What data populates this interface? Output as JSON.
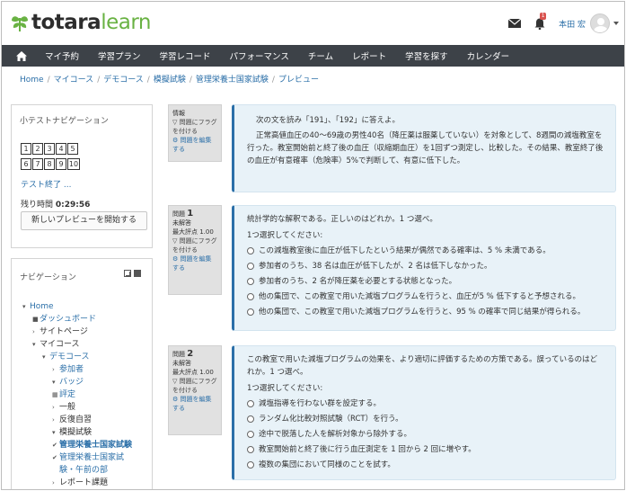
{
  "brand": {
    "name_bold": "totara",
    "name_light": "learn",
    "leaf_color": "#69b243"
  },
  "header": {
    "notifications_count": "1",
    "user_name": "本田 宏"
  },
  "nav": [
    "マイ予約",
    "学習プラン",
    "学習レコード",
    "パフォーマンス",
    "チーム",
    "レポート",
    "学習を探す",
    "カレンダー"
  ],
  "breadcrumb": {
    "items": [
      "Home",
      "マイコース",
      "デモコース",
      "模擬試験",
      "管理栄養士国家試験"
    ],
    "current": "プレビュー"
  },
  "quiz_nav": {
    "title": "小テストナビゲーション",
    "buttons_row1": [
      "1",
      "2",
      "3",
      "4",
      "5"
    ],
    "buttons_row2": [
      "6",
      "7",
      "8",
      "9",
      "10"
    ],
    "finish_link": "テスト終了 ...",
    "time_label": "残り時間",
    "time_value": "0:29:56",
    "new_preview_button": "新しいプレビューを開始する"
  },
  "navigation": {
    "title": "ナビゲーション",
    "tree": [
      {
        "mk": "▾",
        "label": "Home",
        "indent": 0
      },
      {
        "mk": "■",
        "label": "ダッシュボード",
        "indent": 1
      },
      {
        "mk": "›",
        "label": "サイトページ",
        "indent": 1,
        "dark": true
      },
      {
        "mk": "▾",
        "label": "マイコース",
        "indent": 1,
        "dark": true
      },
      {
        "mk": "▾",
        "label": "デモコース",
        "indent": 2
      },
      {
        "mk": "›",
        "label": "参加者",
        "indent": 3
      },
      {
        "mk": "▾",
        "label": "バッジ",
        "indent": 3
      },
      {
        "mk": "▦",
        "label": "評定",
        "indent": 3
      },
      {
        "mk": "›",
        "label": "一般",
        "indent": 3,
        "dark": true
      },
      {
        "mk": "›",
        "label": "反復自習",
        "indent": 3,
        "dark": true
      },
      {
        "mk": "▾",
        "label": "模擬試験",
        "indent": 3,
        "dark": true
      },
      {
        "mk": "✔",
        "label": "管理栄養士国家試験",
        "indent": 3,
        "bold": true
      },
      {
        "mk": "✔",
        "label": "管理栄養士国家試",
        "indent": 3
      },
      {
        "mk": "",
        "label": "験・午前の部",
        "indent": 3
      },
      {
        "mk": "›",
        "label": "レポート課題",
        "indent": 3,
        "dark": true
      }
    ]
  },
  "info_block": {
    "label": "情報",
    "flag": "問題にフラグを付ける",
    "edit": "問題を編集する",
    "text1": "次の文を読み「191」、「192」に答えよ。",
    "text2": "正常高値血圧の40〜69歳の男性40名（降圧薬は服薬していない）を対象として、8週間の減塩教室を行った。教室開始前と終了後の血圧（収縮期血圧）を1回ずつ測定し、比較した。その結果、教室終了後の血圧が有意確率（危険率）5%で判断して、有意に低下した。"
  },
  "questions": [
    {
      "label": "問題",
      "number": "1",
      "status": "未解答",
      "points": "最大評点 1.00",
      "flag": "問題にフラグを付ける",
      "edit": "問題を編集する",
      "text": "統計学的な解釈である。正しいのはどれか。1 つ選べ。",
      "prompt": "1つ選択してください:",
      "options": [
        "この減塩教室後に血圧が低下したという結果が偶然である確率は、5 % 未満である。",
        "参加者のうち、38 名は血圧が低下したが、2 名は低下しなかった。",
        "参加者のうち、2 名が降圧薬を必要とする状態となった。",
        "他の集団で、この教室で用いた減塩プログラムを行うと、血圧が5 % 低下すると予想される。",
        "他の集団で、この教室で用いた減塩プログラムを行うと、95 % の確率で同じ結果が得られる。"
      ]
    },
    {
      "label": "問題",
      "number": "2",
      "status": "未解答",
      "points": "最大評点 1.00",
      "flag": "問題にフラグを付ける",
      "edit": "問題を編集する",
      "text": "この教室で用いた減塩プログラムの効果を、より適切に評価するための方策である。誤っているのはどれか。1 つ選べ。",
      "prompt": "1つ選択してください:",
      "options": [
        "減塩指導を行わない群を設定する。",
        "ランダム化比較対照試験（RCT）を行う。",
        "途中で脱落した人を解析対象から除外する。",
        "教室開始前と終了後に行う血圧測定を 1 回から 2 回に増やす。",
        "複数の集団において同様のことを試す。"
      ]
    }
  ]
}
